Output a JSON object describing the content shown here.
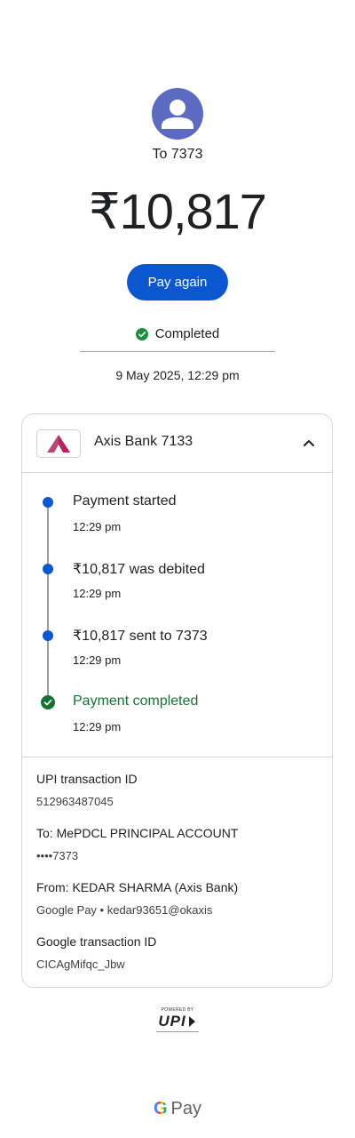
{
  "header": {
    "recipient": "To 7373",
    "amount": "₹10,817",
    "pay_again_label": "Pay again",
    "status": "Completed",
    "datetime": "9 May 2025, 12:29 pm"
  },
  "bank": {
    "name": "Axis Bank 7133",
    "logo_color": "#ae275f"
  },
  "timeline": [
    {
      "title": "Payment started",
      "time": "12:29 pm",
      "state": "done"
    },
    {
      "title": "₹10,817 was debited",
      "time": "12:29 pm",
      "state": "done"
    },
    {
      "title": "₹10,817 sent to 7373",
      "time": "12:29 pm",
      "state": "done"
    },
    {
      "title": "Payment completed",
      "time": "12:29 pm",
      "state": "completed"
    }
  ],
  "details": [
    {
      "label": "UPI transaction ID",
      "value": "512963487045"
    },
    {
      "label": "To: MePDCL PRINCIPAL ACCOUNT",
      "value": "••••7373"
    },
    {
      "label": "From: KEDAR SHARMA (Axis Bank)",
      "value": "Google Pay • kedar93651@okaxis"
    },
    {
      "label": "Google transaction ID",
      "value": "CICAgMifqc_Jbw"
    }
  ],
  "footer": {
    "upi_powered": "POWERED BY",
    "upi_text": "UPI",
    "gpay_g": "G",
    "gpay_text": "Pay"
  },
  "colors": {
    "primary_blue": "#0b57d0",
    "success_green": "#137333",
    "avatar_bg": "#5c6bc0"
  }
}
